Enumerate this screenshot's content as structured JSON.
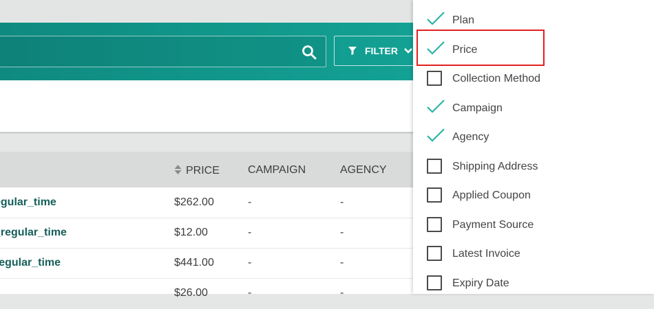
{
  "search": {
    "placeholder": ""
  },
  "filter": {
    "label": "FILTER"
  },
  "table": {
    "columns": {
      "price": "PRICE",
      "campaign": "CAMPAIGN",
      "agency": "AGENCY"
    },
    "rows": [
      {
        "name": "egular_time",
        "price": "$262.00",
        "campaign": "-",
        "agency": "-"
      },
      {
        "name": "_regular_time",
        "price": "$12.00",
        "campaign": "-",
        "agency": "-"
      },
      {
        "name": "regular_time",
        "price": "$441.00",
        "campaign": "-",
        "agency": "-"
      },
      {
        "name": "",
        "price": "$26.00",
        "campaign": "-",
        "agency": "-"
      }
    ]
  },
  "column_menu": {
    "options": [
      {
        "label": "Plan",
        "checked": true
      },
      {
        "label": "Price",
        "checked": true
      },
      {
        "label": "Collection Method",
        "checked": false
      },
      {
        "label": "Campaign",
        "checked": true
      },
      {
        "label": "Agency",
        "checked": true
      },
      {
        "label": "Shipping Address",
        "checked": false
      },
      {
        "label": "Applied Coupon",
        "checked": false
      },
      {
        "label": "Payment Source",
        "checked": false
      },
      {
        "label": "Latest Invoice",
        "checked": false
      },
      {
        "label": "Expiry Date",
        "checked": false
      }
    ]
  },
  "colors": {
    "teal": "#13a294",
    "link": "#155f5a",
    "check": "#2bb3a6",
    "highlight": "#e41e1e"
  }
}
